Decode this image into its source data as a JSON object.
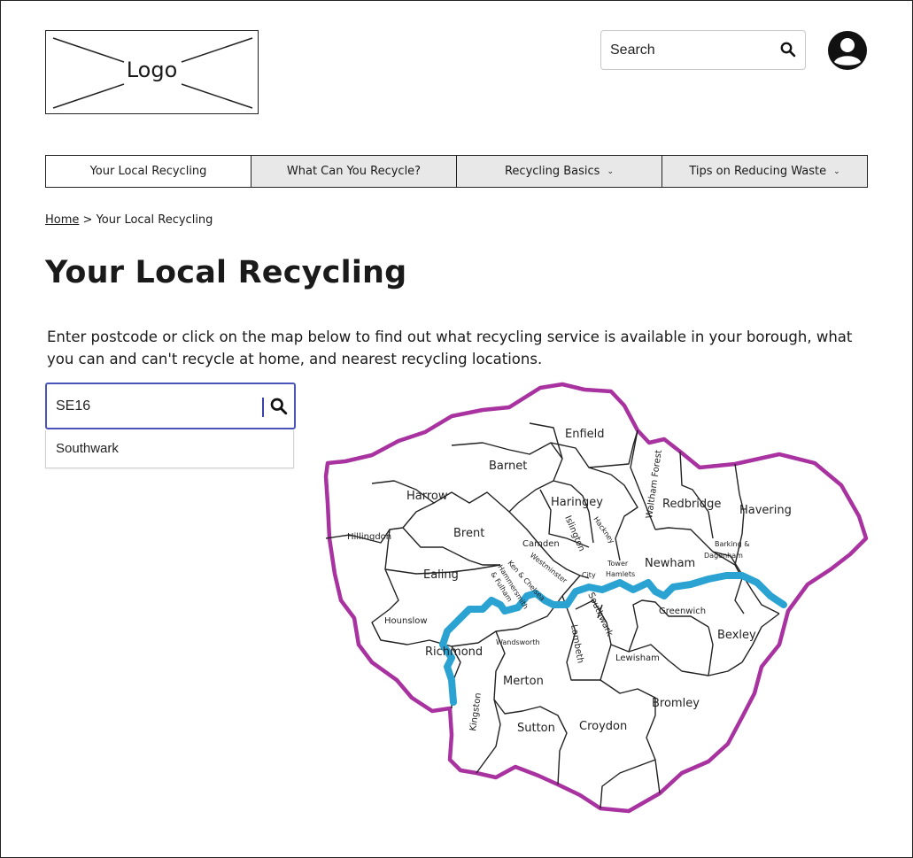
{
  "header": {
    "logo_text": "Logo",
    "search_label": "Search",
    "search_icon": "search-icon",
    "account_icon": "user-account-icon"
  },
  "nav": {
    "items": [
      {
        "label": "Your Local Recycling",
        "dropdown": false
      },
      {
        "label": "What Can You Recycle?",
        "dropdown": false
      },
      {
        "label": "Recycling Basics",
        "dropdown": true
      },
      {
        "label": "Tips on Reducing Waste",
        "dropdown": true
      }
    ]
  },
  "breadcrumb": {
    "home": "Home",
    "separator": " > ",
    "current": "Your Local Recycling"
  },
  "page": {
    "title": "Your Local Recycling",
    "intro": "Enter postcode or click on the map below to find out what recycling service is available in your borough, what you can and can't recycle at home, and nearest recycling locations."
  },
  "postcode_search": {
    "value": "SE16",
    "suggestion": "Southwark"
  },
  "map": {
    "boroughs": [
      "Enfield",
      "Barnet",
      "Harrow",
      "Haringey",
      "Waltham Forest",
      "Redbridge",
      "Havering",
      "Hillingdon",
      "Brent",
      "Camden",
      "Islington",
      "Hackney",
      "Barking & Dagenham",
      "Ealing",
      "Westminster",
      "Kensington & Chelsea",
      "Hammersmith & Fulham",
      "City",
      "Tower Hamlets",
      "Newham",
      "Hounslow",
      "Greenwich",
      "Southwark",
      "Richmond",
      "Wandsworth",
      "Lambeth",
      "Lewisham",
      "Bexley",
      "Merton",
      "Kingston",
      "Bromley",
      "Sutton",
      "Croydon"
    ],
    "labels": {
      "enfield": "Enfield",
      "barnet": "Barnet",
      "harrow": "Harrow",
      "haringey": "Haringey",
      "waltham_forest": "Waltham Forest",
      "redbridge": "Redbridge",
      "havering": "Havering",
      "hillingdon": "Hillingdon",
      "brent": "Brent",
      "camden": "Camden",
      "islington": "Islington",
      "hackney": "Hackney",
      "barking_1": "Barking &",
      "barking_2": "Dagenham",
      "ealing": "Ealing",
      "westminster": "Westminster",
      "kensington_1": "Ken & Chelsea",
      "hammersmith_1": "Hammersmith",
      "hammersmith_2": "& Fulham",
      "city": "City",
      "tower_1": "Tower",
      "tower_2": "Hamlets",
      "newham": "Newham",
      "hounslow": "Hounslow",
      "greenwich": "Greenwich",
      "southwark": "Southwark",
      "richmond": "Richmond",
      "wandsworth": "Wandsworth",
      "lambeth": "Lambeth",
      "lewisham": "Lewisham",
      "bexley": "Bexley",
      "merton": "Merton",
      "kingston": "Kingston",
      "bromley": "Bromley",
      "sutton": "Sutton",
      "croydon": "Croydon"
    },
    "colors": {
      "boundary": "#a8329f",
      "river": "#2aa3d2",
      "borough_lines": "#222222",
      "search_border": "#4a53b8"
    }
  }
}
